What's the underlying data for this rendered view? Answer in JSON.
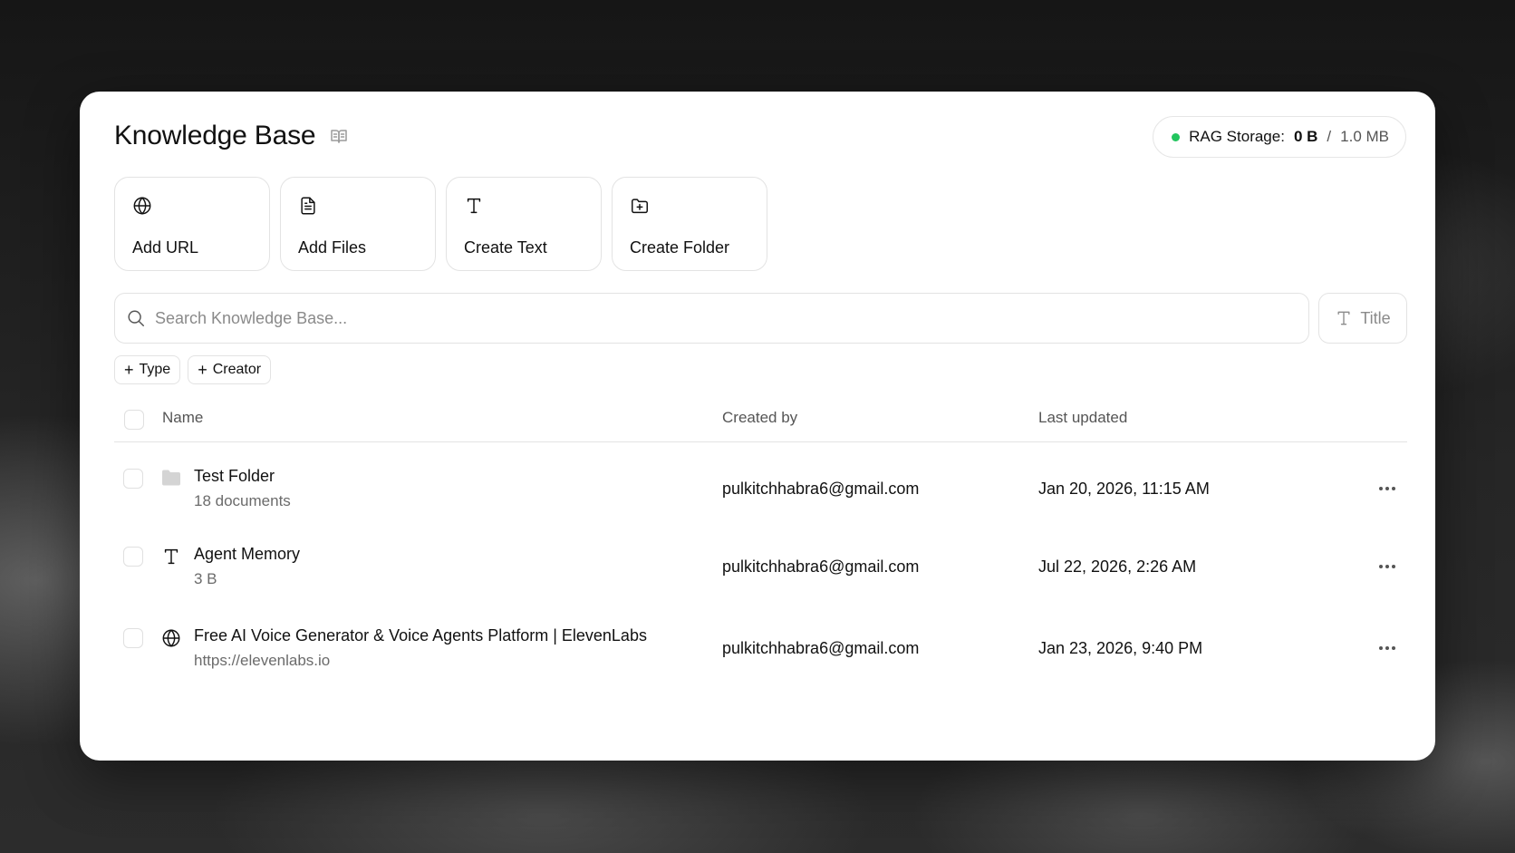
{
  "header": {
    "title": "Knowledge Base",
    "title_icon": "book-open-icon"
  },
  "storage": {
    "label": "RAG Storage:",
    "used": "0 B",
    "separator": "/",
    "total": "1.0 MB",
    "status_color": "#22c55e"
  },
  "actions": [
    {
      "label": "Add URL",
      "icon": "globe-icon"
    },
    {
      "label": "Add Files",
      "icon": "file-text-icon"
    },
    {
      "label": "Create Text",
      "icon": "text-type-icon"
    },
    {
      "label": "Create Folder",
      "icon": "folder-plus-icon"
    }
  ],
  "search": {
    "placeholder": "Search Knowledge Base...",
    "value": ""
  },
  "sort": {
    "label": "Title",
    "icon": "text-type-icon"
  },
  "filters": [
    {
      "label": "Type"
    },
    {
      "label": "Creator"
    }
  ],
  "table": {
    "columns": {
      "name": "Name",
      "created_by": "Created by",
      "last_updated": "Last updated"
    },
    "rows": [
      {
        "name": "Test Folder",
        "sub": "18 documents",
        "created_by": "pulkitchhabra6@gmail.com",
        "last_updated": "Jan 20, 2026, 11:15 AM",
        "icon": "folder-icon"
      },
      {
        "name": "Agent Memory",
        "sub": "3 B",
        "created_by": "pulkitchhabra6@gmail.com",
        "last_updated": "Jul 22, 2026, 2:26 AM",
        "icon": "text-type-icon"
      },
      {
        "name": "Free AI Voice Generator & Voice Agents Platform | ElevenLabs",
        "sub": "https://elevenlabs.io",
        "created_by": "pulkitchhabra6@gmail.com",
        "last_updated": "Jan 23, 2026, 9:40 PM",
        "icon": "globe-icon"
      }
    ]
  }
}
